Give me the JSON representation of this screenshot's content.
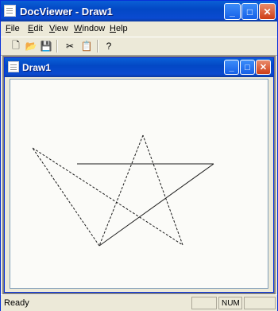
{
  "app": {
    "title": "DocViewer - Draw1",
    "buttons": {
      "minimize": "_",
      "maximize": "□",
      "close": "✕"
    }
  },
  "menu": {
    "items": [
      {
        "first": "F",
        "rest": "ile"
      },
      {
        "first": "E",
        "rest": "dit"
      },
      {
        "first": "V",
        "rest": "iew"
      },
      {
        "first": "W",
        "rest": "indow"
      },
      {
        "first": "H",
        "rest": "elp"
      }
    ]
  },
  "toolbar": {
    "icons": [
      "new-file-icon",
      "open-folder-icon",
      "save-icon",
      "cut-icon",
      "paste-icon",
      "help-icon"
    ],
    "glyphs": {
      "new": "🗋",
      "open": "📂",
      "save": "💾",
      "cut": "✂",
      "paste": "📋",
      "help": "?"
    }
  },
  "document": {
    "title": "Draw1",
    "buttons": {
      "minimize": "_",
      "maximize": "□",
      "close": "✕"
    }
  },
  "drawing": {
    "stroke_color": "#1a1a1a",
    "line_style": "dashed"
  },
  "status": {
    "text": "Ready",
    "indicator": "NUM"
  }
}
